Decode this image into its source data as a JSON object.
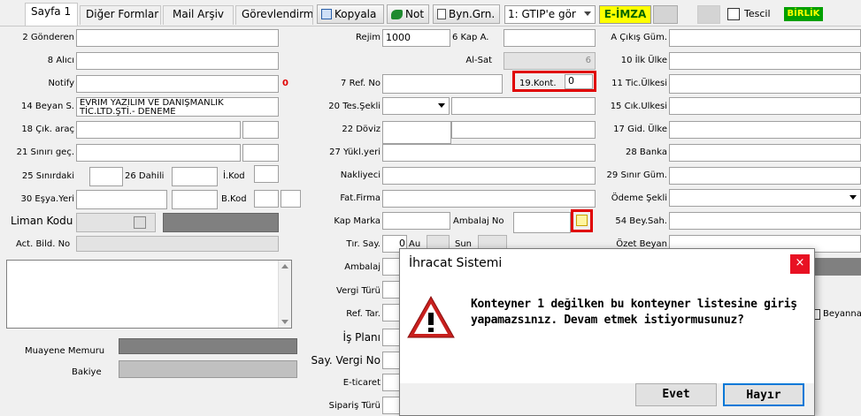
{
  "tabs": [
    {
      "label": "Sayfa 1"
    },
    {
      "label": "Diğer Formlar"
    },
    {
      "label": "Mail Arşiv"
    },
    {
      "label": "Görevlendirme"
    }
  ],
  "toolbar": {
    "kopyala": "Kopyala",
    "not": "Not",
    "byn_grn": "Byn.Grn.",
    "gtip_select": "1: GTIP'e gör",
    "e_imza": "E-İMZA",
    "tescil": "Tescil",
    "birlik": "BİRLİK"
  },
  "left": {
    "gonderen_label": "2 Gönderen",
    "alici_label": "8 Alıcı",
    "notify_label": "Notify",
    "notify_count": "0",
    "beyan_label": "14 Beyan S.",
    "beyan_value": "EVRİM YAZILIM VE DANIŞMANLIK",
    "beyan_value2": "TİC.LTD.ŞTİ.- DENEME",
    "cik_arac_label": "18 Çık. araç",
    "sinir_gec_label": "21 Sınırı geç.",
    "sinirdaki_label": "25 Sınırdaki",
    "dahili_label": "26 Dahili",
    "ikod_label": "İ.Kod",
    "esya_yeri_label": "30 Eşya.Yeri",
    "bkod_label": "B.Kod",
    "liman_kodu_label": "Liman Kodu",
    "act_bild_label": "Act. Bild. No",
    "muayene_label": "Muayene Memuru",
    "bakiye_label": "Bakiye"
  },
  "middle": {
    "rejim_label": "Rejim",
    "rejim_value": "1000",
    "kap_a_label": "6 Kap A.",
    "al_sat_label": "Al-Sat",
    "al_sat_value": "6",
    "ref_no_label": "7 Ref. No",
    "kont_label": "19.Kont.",
    "kont_value": "0",
    "tes_sekli_label": "20 Tes.Şekli",
    "doviz_label": "22 Döviz",
    "yukl_yeri_label": "27 Yükl.yeri",
    "nakliyeci_label": "Nakliyeci",
    "fat_firma_label": "Fat.Firma",
    "kap_marka_label": "Kap Marka",
    "ambalaj_no_label": "Ambalaj No",
    "tir_say_label": "Tır. Say.",
    "tir_say_value": "0",
    "au_label": "Au",
    "sun_label": "Sun",
    "ambalaj_label": "Ambalaj",
    "vergi_turu_label": "Vergi Türü",
    "ref_tar_label": "Ref. Tar.",
    "is_plani_label": "İş Planı",
    "say_vergi_no_label": "Say. Vergi No",
    "e_ticaret_label": "E-ticaret",
    "siparis_turu_label": "Sipariş Türü"
  },
  "right": {
    "a_cikis_label": "A Çıkış Güm.",
    "ilk_ulke_label": "10 İlk Ülke",
    "tic_ulkesi_label": "11 Tic.Ülkesi",
    "cik_ulkesi_label": "15 Cık.Ulkesi",
    "gid_ulke_label": "17 Gid. Ülke",
    "banka_label": "28 Banka",
    "sinir_gum_label": "29 Sınır Güm.",
    "odeme_sekli_label": "Ödeme Şekli",
    "bey_sah_label": "54 Bey.Sah.",
    "ozet_beyan_label": "Özet Beyan",
    "beyanname_label": "Beyanna"
  },
  "dialog": {
    "title": "İhracat Sistemi",
    "close": "×",
    "message_line1": "Konteyner 1 değilken bu konteyner listesine giriş",
    "message_line2": "yapamazsınız. Devam etmek istiyormusunuz?",
    "yes": "Evet",
    "no": "Hayır"
  }
}
